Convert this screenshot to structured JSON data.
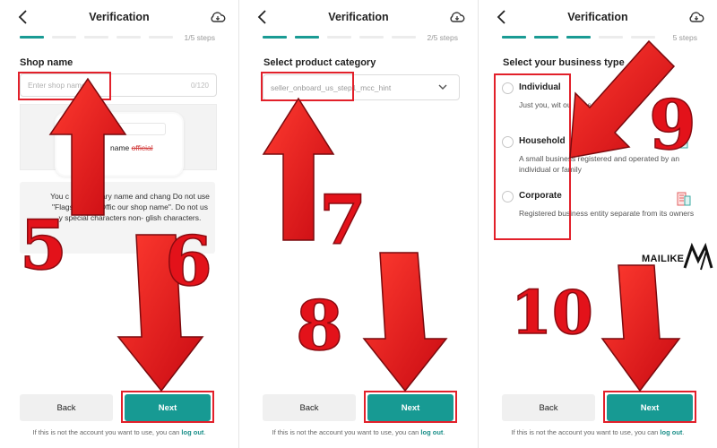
{
  "panels": [
    {
      "title": "Verification",
      "steps": "1/5 steps",
      "active_segments": 1,
      "section_title": "Shop name",
      "input": {
        "placeholder": "Enter shop name",
        "counter": "0/120"
      },
      "illustration": {
        "search_text": "Se",
        "name": "name",
        "struck": "official"
      },
      "hint_text": "You c        a temporary name and chang         Do not use \"Flagship\" or \"Offic         our shop name\". Do not us         y      special characters      non-         glish characters.",
      "back_label": "Back",
      "next_label": "Next",
      "footer_text": "If this is not the account you want to use, you can ",
      "footer_link": "log out",
      "footer_end": "."
    },
    {
      "title": "Verification",
      "steps": "2/5 steps",
      "active_segments": 2,
      "section_title": "Select product category",
      "select_value": "seller_onboard_us_step1_mcc_hint",
      "back_label": "Back",
      "next_label": "Next",
      "footer_text": "If this is not the account you want to use, you can ",
      "footer_link": "log out",
      "footer_end": "."
    },
    {
      "title": "Verification",
      "steps": "5 steps",
      "active_segments": 3,
      "section_title": "Select your business type",
      "options": [
        {
          "title": "Individual",
          "desc": "Just you, wit       ou        ess setup or regist"
        },
        {
          "title": "Household",
          "desc": "A small business registered and operated by an individual or family"
        },
        {
          "title": "Corporate",
          "desc": "Registered business entity separate from its owners"
        }
      ],
      "back_label": "Back",
      "next_label": "Next",
      "footer_text": "If this is not the account you want to use, you can ",
      "footer_link": "log out",
      "footer_end": "."
    }
  ],
  "annotations": {
    "numbers": [
      "5",
      "6",
      "7",
      "8",
      "9",
      "10"
    ]
  },
  "watermark": {
    "text": "MAILIKE"
  },
  "colors": {
    "accent": "#179a93",
    "annotation_red": "#e2202a",
    "progress_inactive": "#ececec"
  },
  "icons": [
    "back-arrow-icon",
    "cloud-icon",
    "chevron-down-icon",
    "search-icon"
  ]
}
